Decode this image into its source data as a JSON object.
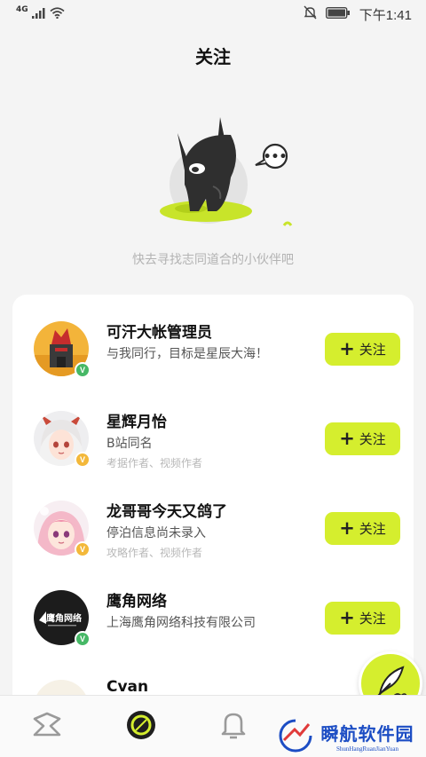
{
  "status": {
    "network": "4G",
    "time": "下午1:41"
  },
  "header": {
    "title": "关注"
  },
  "empty": {
    "hint": "快去寻找志同道合的小伙伴吧",
    "bubble": "•••"
  },
  "users": [
    {
      "name": "可汗大帐管理员",
      "desc": "与我同行，目标是星辰大海！",
      "sub": "",
      "badge_color": "#46b866"
    },
    {
      "name": "星辉月怡",
      "desc": "B站同名",
      "sub": "考据作者、视频作者",
      "badge_color": "#f3b83a"
    },
    {
      "name": "龙哥哥今天又鸽了",
      "desc": "停泊信息尚未录入",
      "sub": "攻略作者、视频作者",
      "badge_color": "#f3b83a"
    },
    {
      "name": "鹰角网络",
      "desc": "上海鹰角网络科技有限公司",
      "sub": "",
      "badge_color": "#46b866"
    },
    {
      "name": "Cvan",
      "desc": "",
      "sub": ""
    }
  ],
  "follow_label": "关注",
  "avatar_text": {
    "hypergryph": "鹰角网络"
  },
  "nav": [
    {
      "icon": "home-icon"
    },
    {
      "icon": "follow-icon"
    },
    {
      "icon": "bell-icon"
    }
  ],
  "watermark": {
    "title": "瞬航软件园",
    "subtitle": "ShunHangRuanJianYuan"
  },
  "colors": {
    "accent": "#d5ee2e",
    "verified_green": "#46b866",
    "verified_orange": "#f3b83a"
  }
}
